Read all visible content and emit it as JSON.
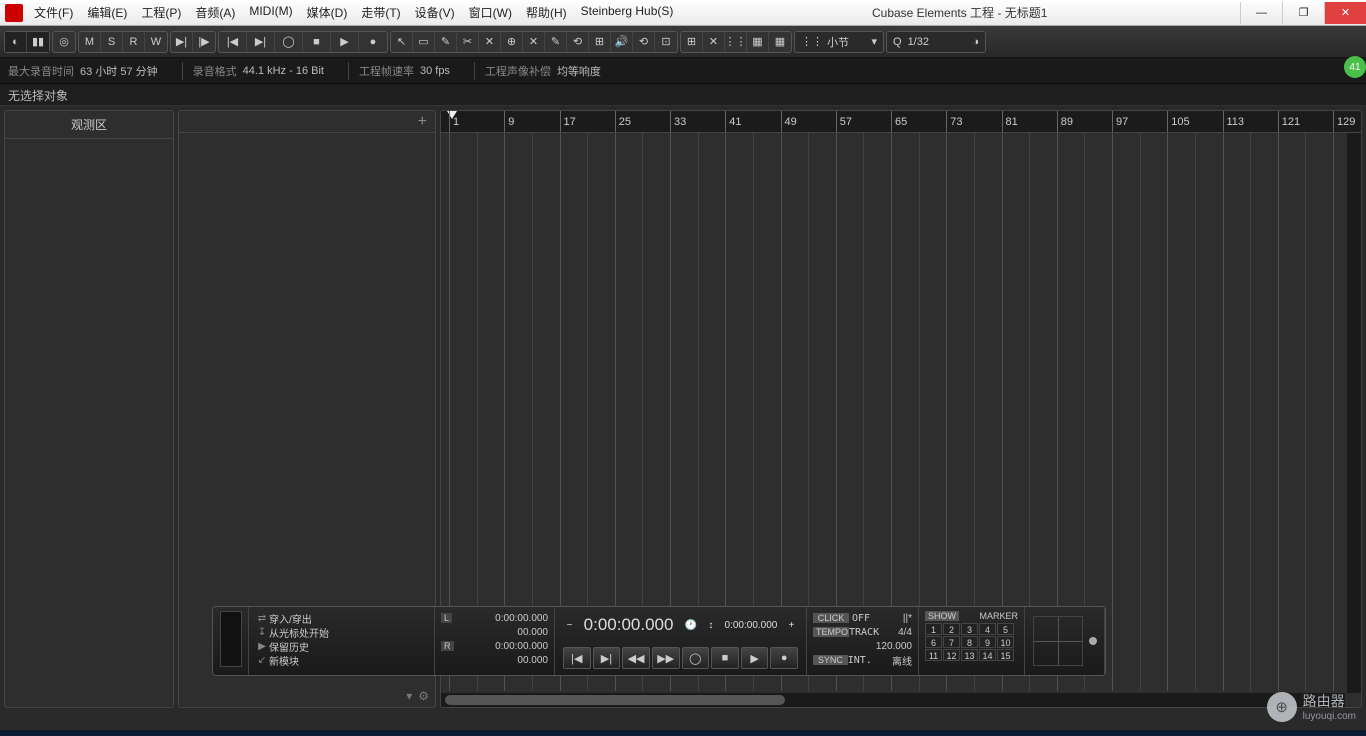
{
  "title": "Cubase Elements 工程 - 无标题1",
  "menus": [
    "文件(F)",
    "编辑(E)",
    "工程(P)",
    "音频(A)",
    "MIDI(M)",
    "媒体(D)",
    "走带(T)",
    "设备(V)",
    "窗口(W)",
    "帮助(H)",
    "Steinberg Hub(S)"
  ],
  "winbtns": {
    "min": "—",
    "max": "❐",
    "close": "✕"
  },
  "toolbar": {
    "msrw": [
      "M",
      "S",
      "R",
      "W"
    ],
    "transport_icons": [
      "|◀",
      "▶|",
      "◯",
      "■",
      "▶",
      "●"
    ],
    "tools": [
      "↖",
      "▭",
      "✎",
      "✂",
      "✕",
      "⊕",
      "✕",
      "✎",
      "⟲",
      "⊞",
      "🔊",
      "⟲",
      "⊡"
    ],
    "snap_icons": [
      "⊞",
      "✕",
      "⋮⋮",
      "▦",
      "▦"
    ],
    "grid_label": "小节",
    "q_label": "Q",
    "q_value": "1/32"
  },
  "secbar": {
    "items": [
      {
        "lbl": "最大录音时间",
        "val": "63 小时 57 分钟"
      },
      {
        "lbl": "录音格式",
        "val": "44.1 kHz - 16 Bit"
      },
      {
        "lbl": "工程帧速率",
        "val": "30 fps"
      },
      {
        "lbl": "工程声像补偿",
        "val": "均等响度"
      }
    ],
    "badge": "41"
  },
  "info": "无选择对象",
  "inspector": {
    "title": "观测区"
  },
  "tracklist": {
    "add": "+",
    "foot": [
      "▾",
      "⚙"
    ]
  },
  "ruler": {
    "start": 1,
    "ticks": [
      1,
      9,
      17,
      25,
      33,
      41,
      49,
      57,
      65,
      73,
      81,
      89,
      97,
      105,
      113,
      121,
      129
    ]
  },
  "transport": {
    "list": [
      {
        "ic": "⇄",
        "txt": "穿入/穿出"
      },
      {
        "ic": "↧",
        "txt": "从光标处开始"
      },
      {
        "ic": "▶",
        "txt": "保留历史"
      },
      {
        "ic": "↙",
        "txt": "新模块"
      }
    ],
    "times": [
      {
        "tag": "L",
        "val": "0:00:00.000"
      },
      {
        "tag": "",
        "val": "00.000"
      },
      {
        "tag": "R",
        "val": "0:00:00.000"
      },
      {
        "tag": "",
        "val": "00.000"
      }
    ],
    "main_times": [
      "0:00:00.000",
      "0:00:00.000"
    ],
    "btns": [
      "|◀",
      "▶|",
      "◀◀",
      "▶▶",
      "◯",
      "■",
      "▶",
      "●"
    ],
    "right": [
      {
        "tag": "CLICK",
        "val": "OFF",
        "ex": "||*"
      },
      {
        "tag": "TEMPO",
        "val": "TRACK",
        "ex": "4/4"
      },
      {
        "tag": "",
        "val": "",
        "ex": "120.000"
      },
      {
        "tag": "SYNC",
        "val": "INT.",
        "ex": "离线"
      }
    ],
    "marker": {
      "show": "SHOW",
      "label": "MARKER",
      "nums": [
        1,
        2,
        3,
        4,
        5,
        6,
        7,
        8,
        9,
        10,
        11,
        12,
        13,
        14,
        15
      ]
    }
  },
  "wm": {
    "t1": "路由器",
    "t2": "luyouqi.com",
    "ic": "⊕"
  }
}
